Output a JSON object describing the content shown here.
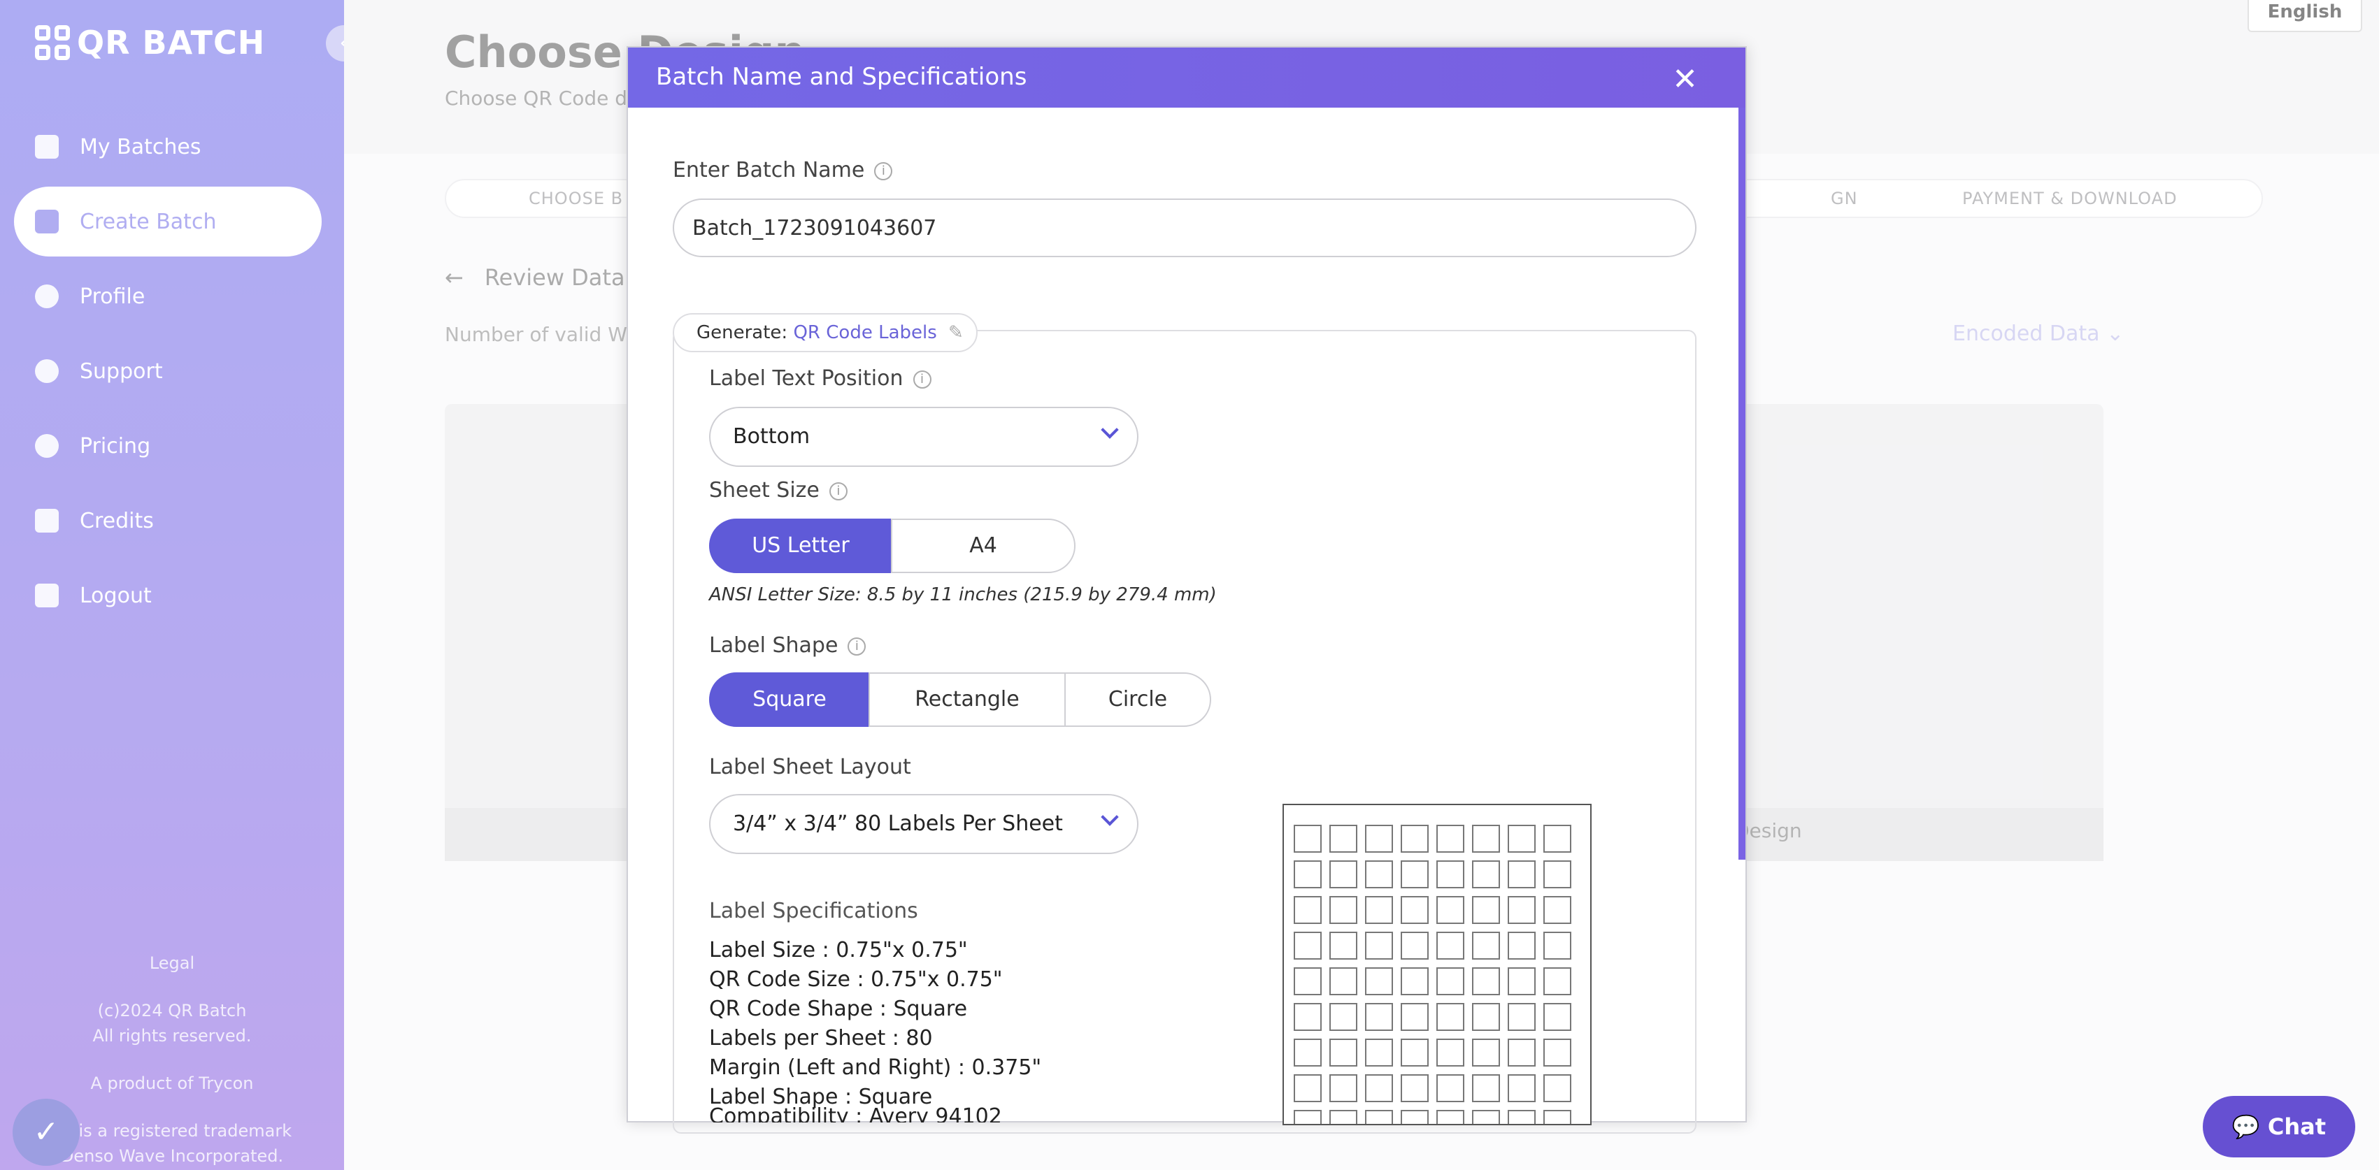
{
  "app": {
    "name": "QR BATCH",
    "language": "English"
  },
  "sidebar": {
    "items": [
      {
        "label": "My Batches",
        "icon": "list-icon"
      },
      {
        "label": "Create Batch",
        "icon": "grid-plus-icon",
        "active": true
      },
      {
        "label": "Profile",
        "icon": "user-icon"
      },
      {
        "label": "Support",
        "icon": "help-icon"
      },
      {
        "label": "Pricing",
        "icon": "dollar-icon"
      },
      {
        "label": "Credits",
        "icon": "coins-icon"
      },
      {
        "label": "Logout",
        "icon": "logout-icon"
      }
    ],
    "footer": {
      "legal": "Legal",
      "copyright": "(c)2024 QR Batch",
      "rights": "All rights reserved.",
      "product": "A product of Trycon",
      "trademark1": "de is a registered trademark",
      "trademark2": "Denso Wave Incorporated."
    }
  },
  "main": {
    "title": "Choose Design",
    "subtitle": "Choose QR Code d",
    "steps": [
      "CHOOSE B",
      "GN",
      "PAYMENT & DOWNLOAD"
    ],
    "review": "Review Data",
    "valid_text": "Number of valid W",
    "encoded": "Encoded Data",
    "design_label": "Design"
  },
  "modal": {
    "title": "Batch Name and Specifications",
    "batch_name_label": "Enter Batch Name",
    "batch_name_value": "Batch_1723091043607",
    "generate_label": "Generate:",
    "generate_value": "QR Code Labels",
    "text_position_label": "Label Text Position",
    "text_position_value": "Bottom",
    "sheet_size_label": "Sheet Size",
    "sheet_sizes": [
      "US Letter",
      "A4"
    ],
    "sheet_size_selected": "US Letter",
    "sheet_note": "ANSI Letter Size: 8.5 by 11 inches (215.9 by 279.4 mm)",
    "shape_label": "Label Shape",
    "shapes": [
      "Square",
      "Rectangle",
      "Circle"
    ],
    "shape_selected": "Square",
    "layout_label": "Label Sheet Layout",
    "layout_value": "3/4” x 3/4” 80 Labels Per Sheet",
    "specs_title": "Label Specifications",
    "specs": [
      "Label Size : 0.75\"x 0.75\"",
      "QR Code Size : 0.75\"x 0.75\"",
      "QR Code Shape : Square",
      "Labels per Sheet : 80",
      "Margin (Left and Right) : 0.375\"",
      "Label Shape : Square",
      "Compatibility : Avery 94102"
    ],
    "sheet_preview": {
      "columns": 8,
      "labels": 80
    }
  },
  "chat": {
    "label": "Chat"
  },
  "colors": {
    "accent": "#5f5ad8",
    "sidebar": "#6a68ea",
    "chat": "#6650d2"
  }
}
